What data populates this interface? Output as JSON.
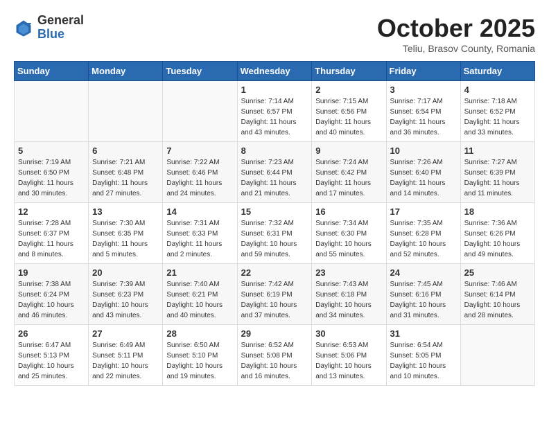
{
  "logo": {
    "general": "General",
    "blue": "Blue"
  },
  "header": {
    "month": "October 2025",
    "location": "Teliu, Brasov County, Romania"
  },
  "weekdays": [
    "Sunday",
    "Monday",
    "Tuesday",
    "Wednesday",
    "Thursday",
    "Friday",
    "Saturday"
  ],
  "weeks": [
    [
      null,
      null,
      null,
      {
        "day": 1,
        "sunrise": "7:14 AM",
        "sunset": "6:57 PM",
        "daylight": "11 hours and 43 minutes."
      },
      {
        "day": 2,
        "sunrise": "7:15 AM",
        "sunset": "6:56 PM",
        "daylight": "11 hours and 40 minutes."
      },
      {
        "day": 3,
        "sunrise": "7:17 AM",
        "sunset": "6:54 PM",
        "daylight": "11 hours and 36 minutes."
      },
      {
        "day": 4,
        "sunrise": "7:18 AM",
        "sunset": "6:52 PM",
        "daylight": "11 hours and 33 minutes."
      }
    ],
    [
      {
        "day": 5,
        "sunrise": "7:19 AM",
        "sunset": "6:50 PM",
        "daylight": "11 hours and 30 minutes."
      },
      {
        "day": 6,
        "sunrise": "7:21 AM",
        "sunset": "6:48 PM",
        "daylight": "11 hours and 27 minutes."
      },
      {
        "day": 7,
        "sunrise": "7:22 AM",
        "sunset": "6:46 PM",
        "daylight": "11 hours and 24 minutes."
      },
      {
        "day": 8,
        "sunrise": "7:23 AM",
        "sunset": "6:44 PM",
        "daylight": "11 hours and 21 minutes."
      },
      {
        "day": 9,
        "sunrise": "7:24 AM",
        "sunset": "6:42 PM",
        "daylight": "11 hours and 17 minutes."
      },
      {
        "day": 10,
        "sunrise": "7:26 AM",
        "sunset": "6:40 PM",
        "daylight": "11 hours and 14 minutes."
      },
      {
        "day": 11,
        "sunrise": "7:27 AM",
        "sunset": "6:39 PM",
        "daylight": "11 hours and 11 minutes."
      }
    ],
    [
      {
        "day": 12,
        "sunrise": "7:28 AM",
        "sunset": "6:37 PM",
        "daylight": "11 hours and 8 minutes."
      },
      {
        "day": 13,
        "sunrise": "7:30 AM",
        "sunset": "6:35 PM",
        "daylight": "11 hours and 5 minutes."
      },
      {
        "day": 14,
        "sunrise": "7:31 AM",
        "sunset": "6:33 PM",
        "daylight": "11 hours and 2 minutes."
      },
      {
        "day": 15,
        "sunrise": "7:32 AM",
        "sunset": "6:31 PM",
        "daylight": "10 hours and 59 minutes."
      },
      {
        "day": 16,
        "sunrise": "7:34 AM",
        "sunset": "6:30 PM",
        "daylight": "10 hours and 55 minutes."
      },
      {
        "day": 17,
        "sunrise": "7:35 AM",
        "sunset": "6:28 PM",
        "daylight": "10 hours and 52 minutes."
      },
      {
        "day": 18,
        "sunrise": "7:36 AM",
        "sunset": "6:26 PM",
        "daylight": "10 hours and 49 minutes."
      }
    ],
    [
      {
        "day": 19,
        "sunrise": "7:38 AM",
        "sunset": "6:24 PM",
        "daylight": "10 hours and 46 minutes."
      },
      {
        "day": 20,
        "sunrise": "7:39 AM",
        "sunset": "6:23 PM",
        "daylight": "10 hours and 43 minutes."
      },
      {
        "day": 21,
        "sunrise": "7:40 AM",
        "sunset": "6:21 PM",
        "daylight": "10 hours and 40 minutes."
      },
      {
        "day": 22,
        "sunrise": "7:42 AM",
        "sunset": "6:19 PM",
        "daylight": "10 hours and 37 minutes."
      },
      {
        "day": 23,
        "sunrise": "7:43 AM",
        "sunset": "6:18 PM",
        "daylight": "10 hours and 34 minutes."
      },
      {
        "day": 24,
        "sunrise": "7:45 AM",
        "sunset": "6:16 PM",
        "daylight": "10 hours and 31 minutes."
      },
      {
        "day": 25,
        "sunrise": "7:46 AM",
        "sunset": "6:14 PM",
        "daylight": "10 hours and 28 minutes."
      }
    ],
    [
      {
        "day": 26,
        "sunrise": "6:47 AM",
        "sunset": "5:13 PM",
        "daylight": "10 hours and 25 minutes."
      },
      {
        "day": 27,
        "sunrise": "6:49 AM",
        "sunset": "5:11 PM",
        "daylight": "10 hours and 22 minutes."
      },
      {
        "day": 28,
        "sunrise": "6:50 AM",
        "sunset": "5:10 PM",
        "daylight": "10 hours and 19 minutes."
      },
      {
        "day": 29,
        "sunrise": "6:52 AM",
        "sunset": "5:08 PM",
        "daylight": "10 hours and 16 minutes."
      },
      {
        "day": 30,
        "sunrise": "6:53 AM",
        "sunset": "5:06 PM",
        "daylight": "10 hours and 13 minutes."
      },
      {
        "day": 31,
        "sunrise": "6:54 AM",
        "sunset": "5:05 PM",
        "daylight": "10 hours and 10 minutes."
      },
      null
    ]
  ],
  "labels": {
    "sunrise": "Sunrise:",
    "sunset": "Sunset:",
    "daylight": "Daylight:"
  }
}
